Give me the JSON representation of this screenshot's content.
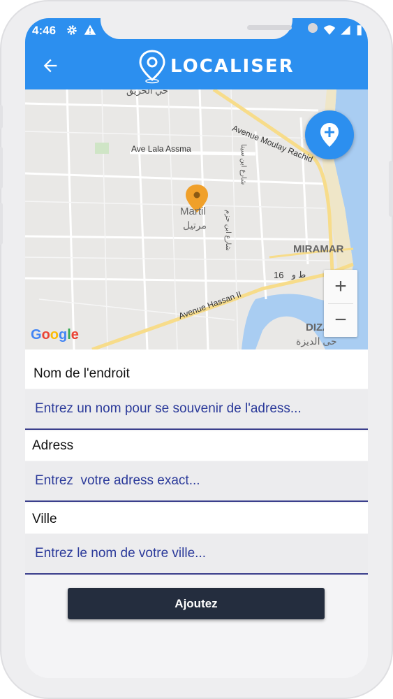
{
  "status_bar": {
    "time": "4:46"
  },
  "app_bar": {
    "title": "LOCALISER"
  },
  "map": {
    "labels": {
      "avenue_moulay_rachid": "Avenue Moulay Rachid",
      "ave_lala_assma": "Ave Lala Assma",
      "martil": "Martil",
      "martil_ar": "مرتيل",
      "miramar": "MIRAMAR",
      "avenue_hassan_ii": "Avenue Hassan II",
      "road_16": "16",
      "road_16_ar": "ط و",
      "diza": "DIZA",
      "diza_ar": "حى الديزة",
      "top_ar": "حي الحريق",
      "street_ar_1": "شارع ابن سينا",
      "street_ar_2": "شارع ابن حزم"
    },
    "google": [
      "G",
      "o",
      "o",
      "g",
      "l",
      "e"
    ],
    "google_colors": [
      "#4285F4",
      "#EA4335",
      "#FBBC05",
      "#4285F4",
      "#34A853",
      "#EA4335"
    ],
    "zoom_in": "+",
    "zoom_out": "−",
    "marker_color": "#f0a02a"
  },
  "form": {
    "name_label": "Nom de l'endroit",
    "name_placeholder": "Entrez un nom pour se souvenir de l'adress...",
    "address_label": "Adress",
    "address_placeholder": "Entrez  votre adress exact...",
    "city_label": "Ville",
    "city_placeholder": "Entrez le nom de votre ville...",
    "submit_label": "Ajoutez"
  },
  "colors": {
    "primary": "#2c8fef",
    "button_dark": "#242d3e",
    "input_text": "#2b3aa0",
    "input_underline": "#3b3f8c"
  }
}
